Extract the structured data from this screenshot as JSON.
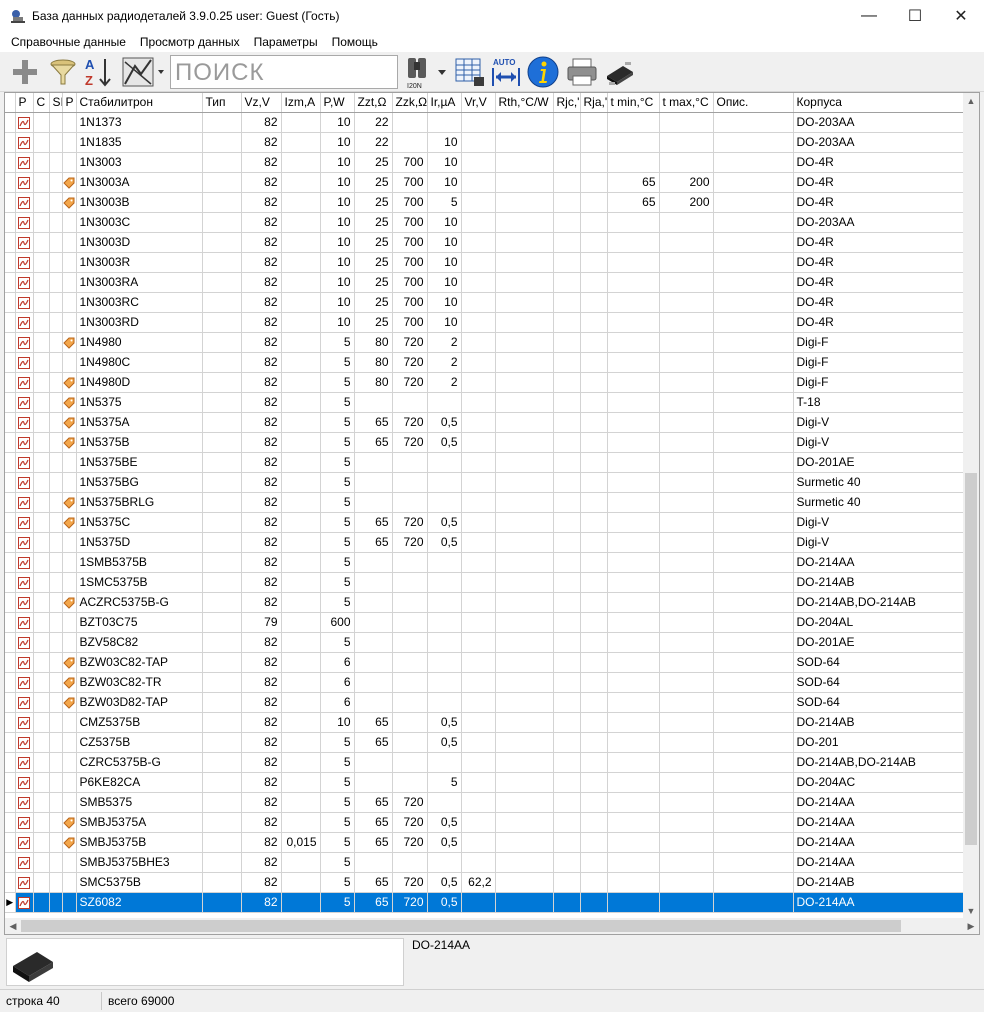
{
  "window": {
    "title": "База данных радиодеталей 3.9.0.25 user: Guest (Гость)",
    "minimize": "—",
    "maximize": "☐",
    "close": "✕"
  },
  "menu": [
    "Справочные данные",
    "Просмотр данных",
    "Параметры",
    "Помощь"
  ],
  "toolbar": {
    "search_placeholder": "ПОИСК",
    "sort_label_a": "A",
    "sort_label_z": "Z",
    "find_caption": "I20N",
    "auto_label": "AUTO"
  },
  "grid": {
    "columns": [
      "P",
      "C",
      "SI",
      "P",
      "Стабилитрон",
      "Тип",
      "Vz,V",
      "Izm,A",
      "P,W",
      "Zzt,Ω",
      "Zzk,Ω",
      "Ir,µA",
      "Vr,V",
      "Rth,°C/W",
      "Rjc,'",
      "Rja,'",
      "t min,°C",
      "t max,°C",
      "Опис.",
      "Корпуса"
    ],
    "selected_index": 39,
    "rows": [
      {
        "tag": false,
        "name": "1N1373",
        "vz": "82",
        "izm": "",
        "p": "10",
        "zzt": "22",
        "zzk": "",
        "ir": "",
        "vr": "",
        "tmin": "",
        "tmax": "",
        "pkg": "DO-203AA"
      },
      {
        "tag": false,
        "name": "1N1835",
        "vz": "82",
        "izm": "",
        "p": "10",
        "zzt": "22",
        "zzk": "",
        "ir": "10",
        "vr": "",
        "tmin": "",
        "tmax": "",
        "pkg": "DO-203AA"
      },
      {
        "tag": false,
        "name": "1N3003",
        "vz": "82",
        "izm": "",
        "p": "10",
        "zzt": "25",
        "zzk": "700",
        "ir": "10",
        "vr": "",
        "tmin": "",
        "tmax": "",
        "pkg": "DO-4R"
      },
      {
        "tag": true,
        "name": "1N3003A",
        "vz": "82",
        "izm": "",
        "p": "10",
        "zzt": "25",
        "zzk": "700",
        "ir": "10",
        "vr": "",
        "tmin": "65",
        "tmax": "200",
        "pkg": "DO-4R"
      },
      {
        "tag": true,
        "name": "1N3003B",
        "vz": "82",
        "izm": "",
        "p": "10",
        "zzt": "25",
        "zzk": "700",
        "ir": "5",
        "vr": "",
        "tmin": "65",
        "tmax": "200",
        "pkg": "DO-4R"
      },
      {
        "tag": false,
        "name": "1N3003C",
        "vz": "82",
        "izm": "",
        "p": "10",
        "zzt": "25",
        "zzk": "700",
        "ir": "10",
        "vr": "",
        "tmin": "",
        "tmax": "",
        "pkg": "DO-203AA"
      },
      {
        "tag": false,
        "name": "1N3003D",
        "vz": "82",
        "izm": "",
        "p": "10",
        "zzt": "25",
        "zzk": "700",
        "ir": "10",
        "vr": "",
        "tmin": "",
        "tmax": "",
        "pkg": "DO-4R"
      },
      {
        "tag": false,
        "name": "1N3003R",
        "vz": "82",
        "izm": "",
        "p": "10",
        "zzt": "25",
        "zzk": "700",
        "ir": "10",
        "vr": "",
        "tmin": "",
        "tmax": "",
        "pkg": "DO-4R"
      },
      {
        "tag": false,
        "name": "1N3003RA",
        "vz": "82",
        "izm": "",
        "p": "10",
        "zzt": "25",
        "zzk": "700",
        "ir": "10",
        "vr": "",
        "tmin": "",
        "tmax": "",
        "pkg": "DO-4R"
      },
      {
        "tag": false,
        "name": "1N3003RC",
        "vz": "82",
        "izm": "",
        "p": "10",
        "zzt": "25",
        "zzk": "700",
        "ir": "10",
        "vr": "",
        "tmin": "",
        "tmax": "",
        "pkg": "DO-4R"
      },
      {
        "tag": false,
        "name": "1N3003RD",
        "vz": "82",
        "izm": "",
        "p": "10",
        "zzt": "25",
        "zzk": "700",
        "ir": "10",
        "vr": "",
        "tmin": "",
        "tmax": "",
        "pkg": "DO-4R"
      },
      {
        "tag": true,
        "name": "1N4980",
        "vz": "82",
        "izm": "",
        "p": "5",
        "zzt": "80",
        "zzk": "720",
        "ir": "2",
        "vr": "",
        "tmin": "",
        "tmax": "",
        "pkg": "Digi-F"
      },
      {
        "tag": false,
        "name": "1N4980C",
        "vz": "82",
        "izm": "",
        "p": "5",
        "zzt": "80",
        "zzk": "720",
        "ir": "2",
        "vr": "",
        "tmin": "",
        "tmax": "",
        "pkg": "Digi-F"
      },
      {
        "tag": true,
        "name": "1N4980D",
        "vz": "82",
        "izm": "",
        "p": "5",
        "zzt": "80",
        "zzk": "720",
        "ir": "2",
        "vr": "",
        "tmin": "",
        "tmax": "",
        "pkg": "Digi-F"
      },
      {
        "tag": true,
        "name": "1N5375",
        "vz": "82",
        "izm": "",
        "p": "5",
        "zzt": "",
        "zzk": "",
        "ir": "",
        "vr": "",
        "tmin": "",
        "tmax": "",
        "pkg": "T-18"
      },
      {
        "tag": true,
        "name": "1N5375A",
        "vz": "82",
        "izm": "",
        "p": "5",
        "zzt": "65",
        "zzk": "720",
        "ir": "0,5",
        "vr": "",
        "tmin": "",
        "tmax": "",
        "pkg": "Digi-V"
      },
      {
        "tag": true,
        "name": "1N5375B",
        "vz": "82",
        "izm": "",
        "p": "5",
        "zzt": "65",
        "zzk": "720",
        "ir": "0,5",
        "vr": "",
        "tmin": "",
        "tmax": "",
        "pkg": "Digi-V"
      },
      {
        "tag": false,
        "name": "1N5375BE",
        "vz": "82",
        "izm": "",
        "p": "5",
        "zzt": "",
        "zzk": "",
        "ir": "",
        "vr": "",
        "tmin": "",
        "tmax": "",
        "pkg": "DO-201AE"
      },
      {
        "tag": false,
        "name": "1N5375BG",
        "vz": "82",
        "izm": "",
        "p": "5",
        "zzt": "",
        "zzk": "",
        "ir": "",
        "vr": "",
        "tmin": "",
        "tmax": "",
        "pkg": "Surmetic 40"
      },
      {
        "tag": true,
        "name": "1N5375BRLG",
        "vz": "82",
        "izm": "",
        "p": "5",
        "zzt": "",
        "zzk": "",
        "ir": "",
        "vr": "",
        "tmin": "",
        "tmax": "",
        "pkg": "Surmetic 40"
      },
      {
        "tag": true,
        "name": "1N5375C",
        "vz": "82",
        "izm": "",
        "p": "5",
        "zzt": "65",
        "zzk": "720",
        "ir": "0,5",
        "vr": "",
        "tmin": "",
        "tmax": "",
        "pkg": "Digi-V"
      },
      {
        "tag": false,
        "name": "1N5375D",
        "vz": "82",
        "izm": "",
        "p": "5",
        "zzt": "65",
        "zzk": "720",
        "ir": "0,5",
        "vr": "",
        "tmin": "",
        "tmax": "",
        "pkg": "Digi-V"
      },
      {
        "tag": false,
        "name": "1SMB5375B",
        "vz": "82",
        "izm": "",
        "p": "5",
        "zzt": "",
        "zzk": "",
        "ir": "",
        "vr": "",
        "tmin": "",
        "tmax": "",
        "pkg": "DO-214AA"
      },
      {
        "tag": false,
        "name": "1SMC5375B",
        "vz": "82",
        "izm": "",
        "p": "5",
        "zzt": "",
        "zzk": "",
        "ir": "",
        "vr": "",
        "tmin": "",
        "tmax": "",
        "pkg": "DO-214AB"
      },
      {
        "tag": true,
        "name": "ACZRC5375B-G",
        "vz": "82",
        "izm": "",
        "p": "5",
        "zzt": "",
        "zzk": "",
        "ir": "",
        "vr": "",
        "tmin": "",
        "tmax": "",
        "pkg": "DO-214AB,DO-214AB"
      },
      {
        "tag": false,
        "name": "BZT03C75",
        "vz": "79",
        "izm": "",
        "p": "600",
        "zzt": "",
        "zzk": "",
        "ir": "",
        "vr": "",
        "tmin": "",
        "tmax": "",
        "pkg": "DO-204AL"
      },
      {
        "tag": false,
        "name": "BZV58C82",
        "vz": "82",
        "izm": "",
        "p": "5",
        "zzt": "",
        "zzk": "",
        "ir": "",
        "vr": "",
        "tmin": "",
        "tmax": "",
        "pkg": "DO-201AE"
      },
      {
        "tag": true,
        "name": "BZW03C82-TAP",
        "vz": "82",
        "izm": "",
        "p": "6",
        "zzt": "",
        "zzk": "",
        "ir": "",
        "vr": "",
        "tmin": "",
        "tmax": "",
        "pkg": "SOD-64"
      },
      {
        "tag": true,
        "name": "BZW03C82-TR",
        "vz": "82",
        "izm": "",
        "p": "6",
        "zzt": "",
        "zzk": "",
        "ir": "",
        "vr": "",
        "tmin": "",
        "tmax": "",
        "pkg": "SOD-64"
      },
      {
        "tag": true,
        "name": "BZW03D82-TAP",
        "vz": "82",
        "izm": "",
        "p": "6",
        "zzt": "",
        "zzk": "",
        "ir": "",
        "vr": "",
        "tmin": "",
        "tmax": "",
        "pkg": "SOD-64"
      },
      {
        "tag": false,
        "name": "CMZ5375B",
        "vz": "82",
        "izm": "",
        "p": "10",
        "zzt": "65",
        "zzk": "",
        "ir": "0,5",
        "vr": "",
        "tmin": "",
        "tmax": "",
        "pkg": "DO-214AB"
      },
      {
        "tag": false,
        "name": "CZ5375B",
        "vz": "82",
        "izm": "",
        "p": "5",
        "zzt": "65",
        "zzk": "",
        "ir": "0,5",
        "vr": "",
        "tmin": "",
        "tmax": "",
        "pkg": "DO-201"
      },
      {
        "tag": false,
        "name": "CZRC5375B-G",
        "vz": "82",
        "izm": "",
        "p": "5",
        "zzt": "",
        "zzk": "",
        "ir": "",
        "vr": "",
        "tmin": "",
        "tmax": "",
        "pkg": "DO-214AB,DO-214AB"
      },
      {
        "tag": false,
        "name": "P6KE82CA",
        "vz": "82",
        "izm": "",
        "p": "5",
        "zzt": "",
        "zzk": "",
        "ir": "5",
        "vr": "",
        "tmin": "",
        "tmax": "",
        "pkg": "DO-204AC"
      },
      {
        "tag": false,
        "name": "SMB5375",
        "vz": "82",
        "izm": "",
        "p": "5",
        "zzt": "65",
        "zzk": "720",
        "ir": "",
        "vr": "",
        "tmin": "",
        "tmax": "",
        "pkg": "DO-214AA"
      },
      {
        "tag": true,
        "name": "SMBJ5375A",
        "vz": "82",
        "izm": "",
        "p": "5",
        "zzt": "65",
        "zzk": "720",
        "ir": "0,5",
        "vr": "",
        "tmin": "",
        "tmax": "",
        "pkg": "DO-214AA"
      },
      {
        "tag": true,
        "name": "SMBJ5375B",
        "vz": "82",
        "izm": "0,015",
        "p": "5",
        "zzt": "65",
        "zzk": "720",
        "ir": "0,5",
        "vr": "",
        "tmin": "",
        "tmax": "",
        "pkg": "DO-214AA"
      },
      {
        "tag": false,
        "name": "SMBJ5375BHE3",
        "vz": "82",
        "izm": "",
        "p": "5",
        "zzt": "",
        "zzk": "",
        "ir": "",
        "vr": "",
        "tmin": "",
        "tmax": "",
        "pkg": "DO-214AA"
      },
      {
        "tag": false,
        "name": "SMC5375B",
        "vz": "82",
        "izm": "",
        "p": "5",
        "zzt": "65",
        "zzk": "720",
        "ir": "0,5",
        "vr": "62,2",
        "tmin": "",
        "tmax": "",
        "pkg": "DO-214AB"
      },
      {
        "tag": false,
        "name": "SZ6082",
        "vz": "82",
        "izm": "",
        "p": "5",
        "zzt": "65",
        "zzk": "720",
        "ir": "0,5",
        "vr": "",
        "tmin": "",
        "tmax": "",
        "pkg": "DO-214AA"
      }
    ]
  },
  "detail": {
    "package": "DO-214AA"
  },
  "status": {
    "row": "строка 40",
    "total": "всего 69000"
  }
}
